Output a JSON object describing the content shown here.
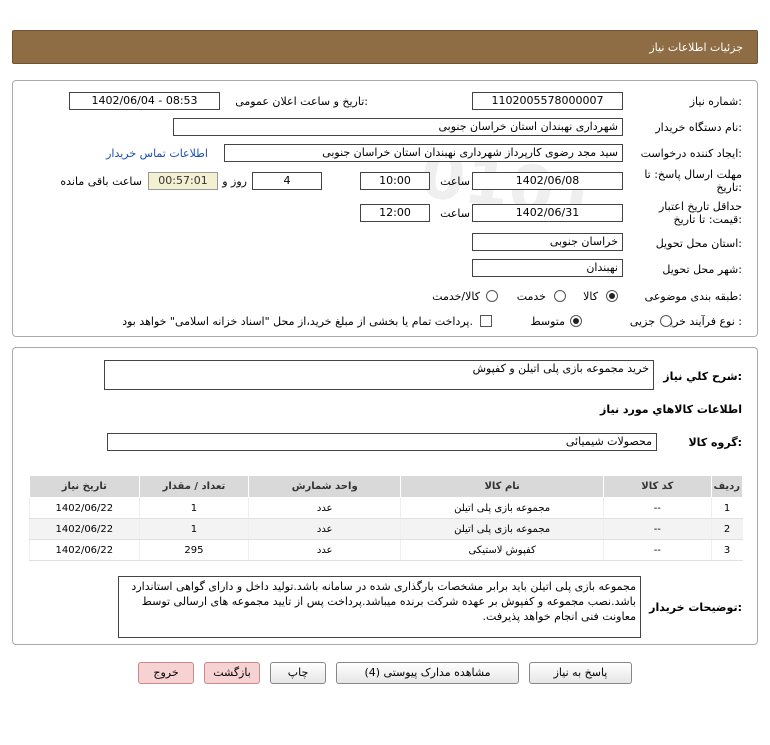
{
  "header": {
    "title": "جزئیات اطلاعات نیاز"
  },
  "info": {
    "need_number_label": "شماره نیاز:",
    "need_number": "1102005578000007",
    "announce_label": "تاریخ و ساعت اعلان عمومی:",
    "announce_value": "1402/06/04 - 08:53",
    "buyer_org_label": "نام دستگاه خریدار:",
    "buyer_org": "شهرداری نهبندان استان خراسان جنوبی",
    "requester_label": "ایجاد کننده درخواست:",
    "requester": "سید مجد رضوی کارپرداز شهرداری نهبندان استان خراسان جنوبی",
    "contact_link": "اطلاعات تماس خریدار",
    "deadline_label_1": "مهلت ارسال پاسخ: تا",
    "deadline_label_2": "تاریخ:",
    "deadline_date": "1402/06/08",
    "time_label": "ساعت",
    "deadline_time": "10:00",
    "days_value": "4",
    "days_label": "روز و",
    "remaining_time": "00:57:01",
    "remaining_label": "ساعت باقی مانده",
    "validity_label_1": "حداقل تاریخ اعتبار",
    "validity_label_2": "قیمت: تا تاریخ:",
    "validity_date": "1402/06/31",
    "validity_time": "12:00",
    "province_label": "استان محل تحویل:",
    "province": "خراسان جنوبی",
    "city_label": "شهر محل تحویل:",
    "city": "نهبندان",
    "category_label": "طبقه بندی موضوعی:",
    "category_options": [
      "کالا",
      "خدمت",
      "کالا/خدمت"
    ],
    "process_label": "نوع فرآیند خرید :",
    "process_options": [
      "جزیی",
      "متوسط"
    ],
    "treasury_note": "پرداخت تمام یا بخشی از مبلغ خرید،از محل \"اسناد خزانه اسلامی\" خواهد بود."
  },
  "details": {
    "general_desc_label": "شرح کلي نياز:",
    "general_desc": "خرید مجموعه بازی پلی اتیلن و کفپوش",
    "goods_info_title": "اطلاعات کالاهاي مورد نياز",
    "goods_group_label": "گروه کالا:",
    "goods_group": "محصولات شیمیائی",
    "table": {
      "headers": [
        "ردیف",
        "کد کالا",
        "نام کالا",
        "واحد شمارش",
        "تعداد / مقدار",
        "تاریخ نیاز"
      ],
      "rows": [
        [
          "1",
          "--",
          "مجموعه بازی پلی اتیلن",
          "عدد",
          "1",
          "1402/06/22"
        ],
        [
          "2",
          "--",
          "مجموعه بازی پلی اتیلن",
          "عدد",
          "1",
          "1402/06/22"
        ],
        [
          "3",
          "--",
          "کفپوش لاستیکی",
          "عدد",
          "295",
          "1402/06/22"
        ]
      ]
    },
    "buyer_notes_label": "توضیحات خریدار:",
    "buyer_notes": "مجموعه بازی پلی اتیلن باید برابر مشخصات بارگذاری شده در سامانه باشد.تولید داخل و دارای گواهی استاندارد باشد.نصب مجموعه و کفپوش بر عهده شرکت برنده میباشد.پرداخت پس از تایید مجموعه های ارسالی توسط معاونت فنی انجام خواهد پذیرفت."
  },
  "buttons": {
    "reply": "پاسخ به نیاز",
    "attachments": "مشاهده مدارک پیوستی (4)",
    "print": "چاپ",
    "back": "بازگشت",
    "exit": "خروج"
  }
}
